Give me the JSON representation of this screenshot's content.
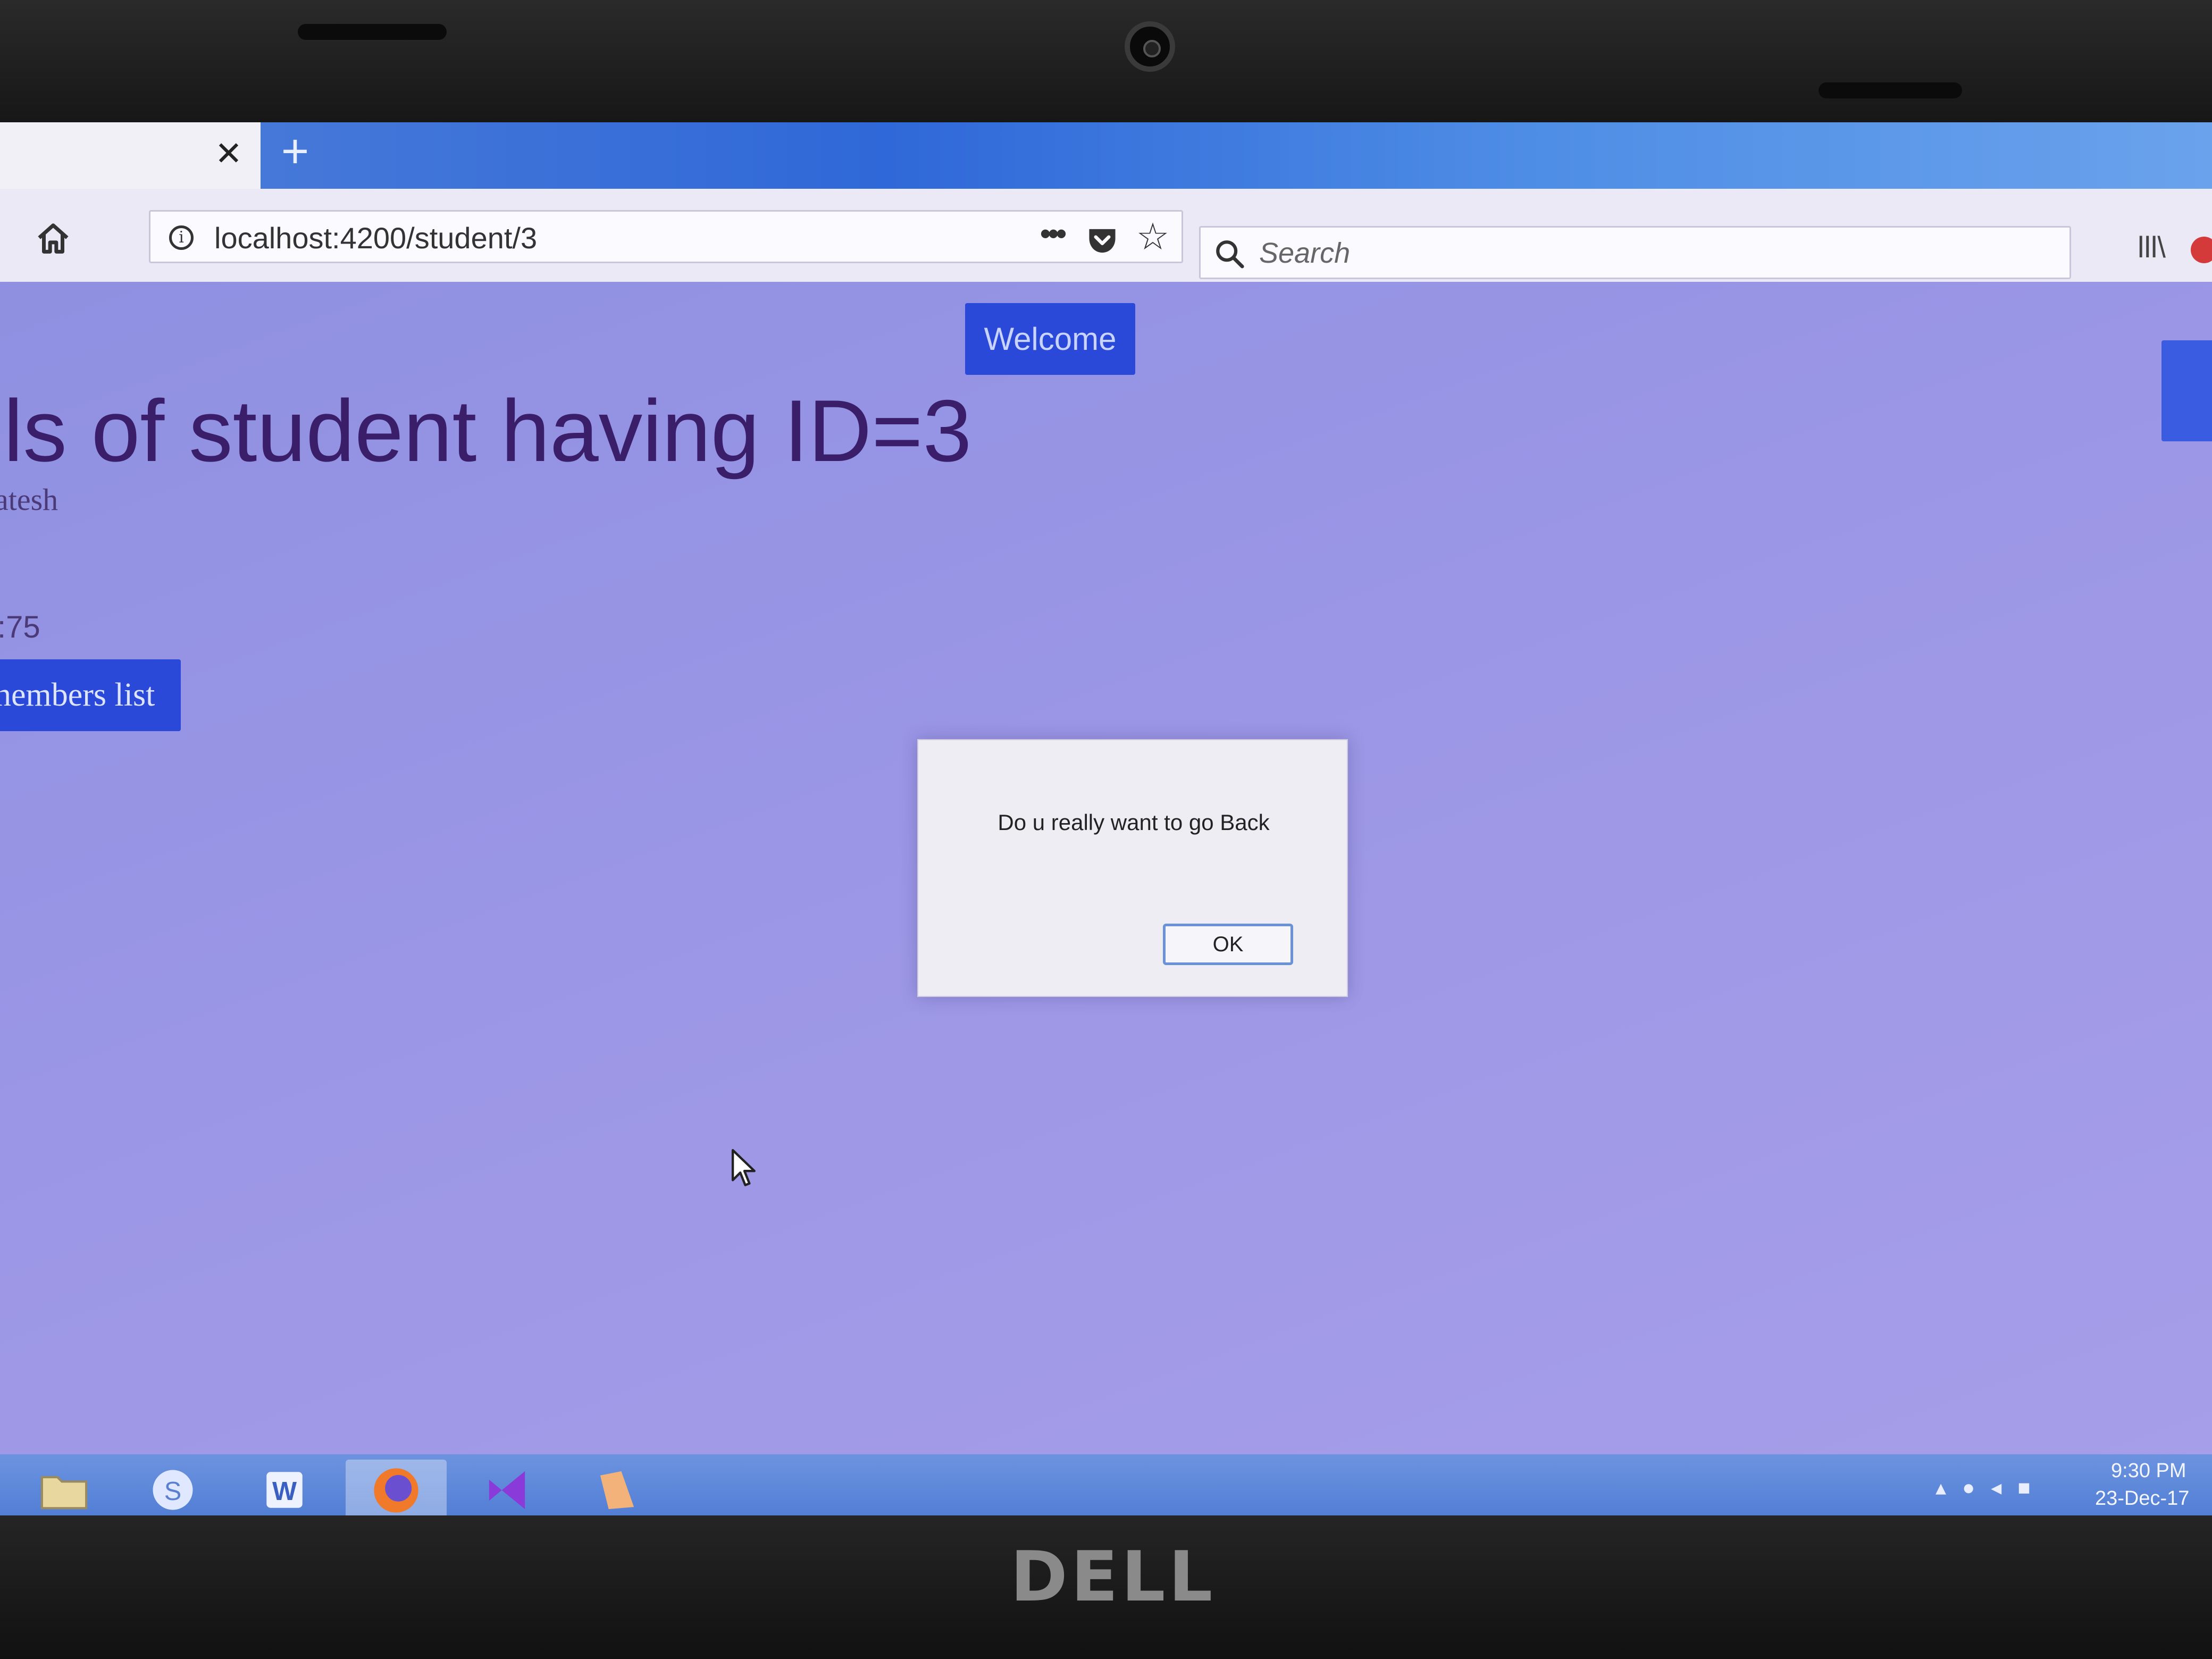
{
  "browser": {
    "tab_close_glyph": "✕",
    "new_tab_glyph": "+",
    "url": "localhost:4200/student/3",
    "search_placeholder": "Search",
    "more_glyph": "•••",
    "star_glyph": "☆",
    "library_glyph": "lll\\"
  },
  "page": {
    "welcome_button": "Welcome",
    "heading": "ils of student having ID=3",
    "name_fragment": "atesh",
    "marks_fragment": ":75",
    "members_button": "nembers list"
  },
  "dialog": {
    "message": "Do u really want to go Back",
    "ok_label": "OK"
  },
  "taskbar": {
    "apps": [
      "file-explorer",
      "skype",
      "word",
      "firefox",
      "visual-studio",
      "app"
    ],
    "active_app": "firefox",
    "clock_time": "9:30 PM",
    "clock_date": "23-Dec-17"
  },
  "hardware": {
    "brand": "DELL"
  },
  "colors": {
    "page_background": "#9b96e6",
    "primary_button": "#2a49d8",
    "heading_text": "#3a1e6a",
    "tab_bar": "#2f68d8"
  }
}
